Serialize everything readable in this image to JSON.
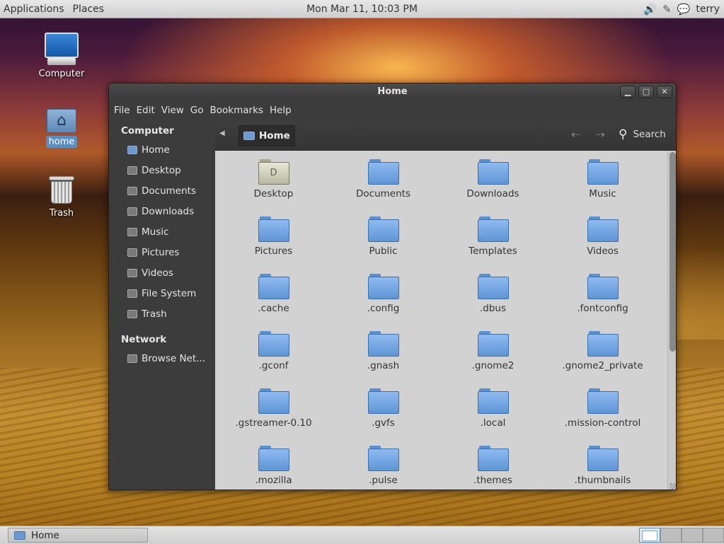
{
  "top_panel": {
    "applications": "Applications",
    "places": "Places",
    "clock": "Mon Mar 11, 10:03 PM",
    "user": "terry",
    "icons": [
      "volume-icon",
      "accessibility-icon",
      "chat-icon"
    ]
  },
  "desktop": {
    "icons": [
      {
        "label": "Computer",
        "icon": "computer-icon"
      },
      {
        "label": "home",
        "icon": "home-folder-icon",
        "selected": true
      },
      {
        "label": "Trash",
        "icon": "trash-icon"
      }
    ]
  },
  "window": {
    "title": "Home",
    "controls": [
      "minimize",
      "maximize",
      "close"
    ],
    "menu": [
      "File",
      "Edit",
      "View",
      "Go",
      "Bookmarks",
      "Help"
    ],
    "sidebar": {
      "computer_heading": "Computer",
      "computer_items": [
        "Home",
        "Desktop",
        "Documents",
        "Downloads",
        "Music",
        "Pictures",
        "Videos",
        "File System",
        "Trash"
      ],
      "network_heading": "Network",
      "network_items": [
        "Browse Net..."
      ]
    },
    "toolbar": {
      "location": "Home",
      "search_label": "Search"
    },
    "files": [
      "Desktop",
      "Documents",
      "Downloads",
      "Music",
      "Pictures",
      "Public",
      "Templates",
      "Videos",
      ".cache",
      ".config",
      ".dbus",
      ".fontconfig",
      ".gconf",
      ".gnash",
      ".gnome2",
      ".gnome2_private",
      ".gstreamer-0.10",
      ".gvfs",
      ".local",
      ".mission-control",
      ".mozilla",
      ".pulse",
      ".themes",
      ".thumbnails"
    ]
  },
  "bottom_panel": {
    "task_label": "Home",
    "workspaces": 4,
    "active_workspace": 1
  }
}
